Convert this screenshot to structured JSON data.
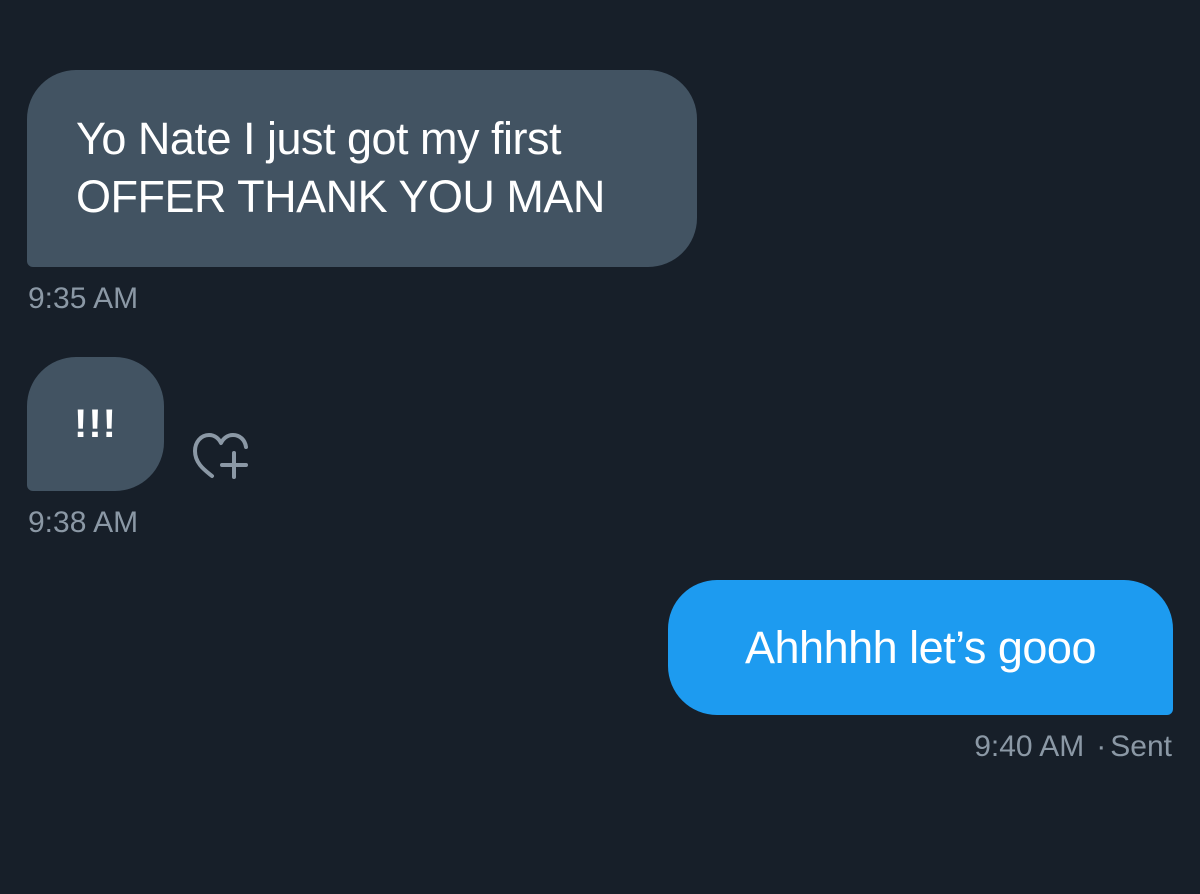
{
  "messages": [
    {
      "direction": "received",
      "lines": [
        "Yo Nate I just got my first",
        "OFFER THANK YOU MAN"
      ],
      "time": "9:35 AM"
    },
    {
      "direction": "received",
      "text": "!!!",
      "time": "9:38 AM",
      "reaction_icon": "heart-plus-icon"
    },
    {
      "direction": "sent",
      "text": "Ahhhhh let’s gooo",
      "time": "9:40 AM",
      "separator": "·",
      "status": "Sent"
    }
  ],
  "colors": {
    "background": "#171f29",
    "received_bubble": "#425362",
    "sent_bubble": "#1d9bf0",
    "meta_text": "#8b98a5",
    "message_text": "#ffffff"
  }
}
